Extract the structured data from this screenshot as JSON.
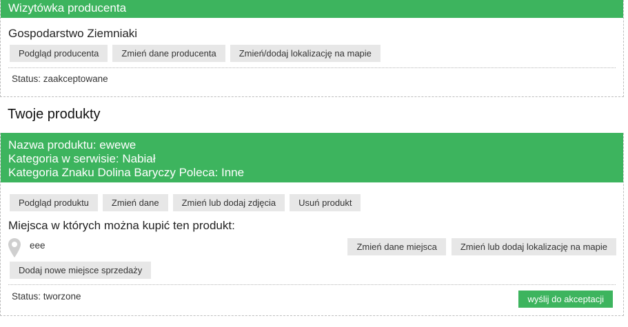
{
  "producer_card": {
    "header": "Wizytówka producenta",
    "name": "Gospodarstwo Ziemniaki",
    "buttons": {
      "preview": "Podgląd producenta",
      "edit": "Zmień dane producenta",
      "location": "Zmień/dodaj lokalizację na mapie"
    },
    "status": "Status: zaakceptowane"
  },
  "section_title": "Twoje produkty",
  "product": {
    "name_line": "Nazwa produktu: ewewe",
    "category_line": "Kategoria w serwisie: Nabiał",
    "sign_category_line": "Kategoria Znaku Dolina Baryczy Poleca: Inne",
    "buttons": {
      "preview": "Podgląd produktu",
      "edit": "Zmień dane",
      "photos": "Zmień lub dodaj zdjęcia",
      "delete": "Usuń produkt"
    },
    "places_heading": "Miejsca w których można kupić ten produkt:",
    "place": {
      "icon": "map-pin-icon",
      "name": "eee",
      "edit_label": "Zmień dane miejsca",
      "location_label": "Zmień lub dodaj lokalizację na mapie"
    },
    "add_place_label": "Dodaj nowe miejsce sprzedaży",
    "status": "Status: tworzone",
    "send_label": "wyślij do akceptacji"
  },
  "colors": {
    "accent": "#3db45e",
    "button_bg": "#e7e7e7",
    "pin": "#cfcfcf"
  }
}
